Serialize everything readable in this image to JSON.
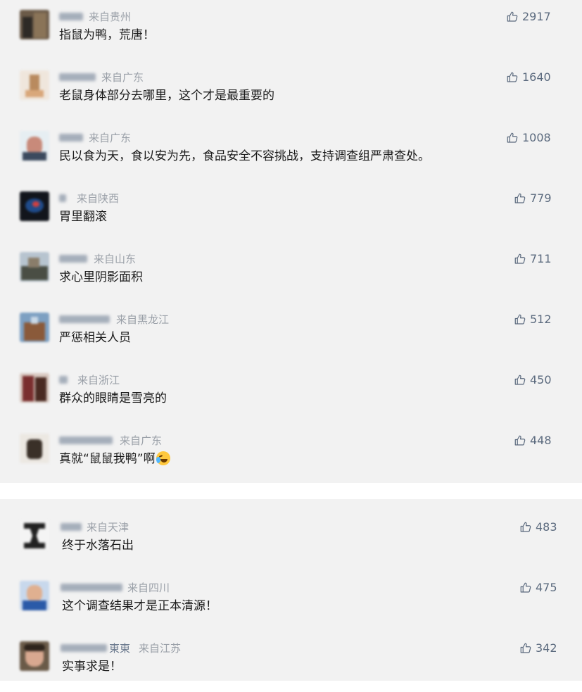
{
  "section_a": {
    "comments": [
      {
        "location": "来自贵州",
        "text": "指鼠为鸭，荒唐！",
        "likes": "2917"
      },
      {
        "location": "来自广东",
        "text": "老鼠身体部分去哪里，这个才是最重要的",
        "likes": "1640"
      },
      {
        "location": "来自广东",
        "text": "民以食为天，食以安为先，食品安全不容挑战，支持调查组严肃查处。",
        "likes": "1008"
      },
      {
        "location": "来自陕西",
        "text": "胃里翻滚",
        "likes": "779"
      },
      {
        "location": "来自山东",
        "text": "求心里阴影面积",
        "likes": "711"
      },
      {
        "location": "来自黑龙江",
        "text": "严惩相关人员",
        "likes": "512"
      },
      {
        "location": "来自浙江",
        "text": "群众的眼睛是雪亮的",
        "likes": "450"
      },
      {
        "location": "来自广东",
        "text": "真就“鼠鼠我鸭”啊",
        "likes": "448",
        "emoji": "laughing-crying-emoji"
      }
    ]
  },
  "section_b": {
    "comments": [
      {
        "location": "来自天津",
        "text": "终于水落石出",
        "likes": "483"
      },
      {
        "location": "来自四川",
        "text": "这个调查结果才是正本清源！",
        "likes": "475"
      },
      {
        "nickname_visible": "東東",
        "location": "来自江苏",
        "text": "实事求是！",
        "likes": "342"
      }
    ]
  },
  "icons": {
    "like": "thumbs-up-outline-icon"
  },
  "colors": {
    "background": "#f2f2f2",
    "divider": "#ffffff",
    "text": "#1a1a1a",
    "location": "#9aa0a8",
    "like": "#5b6a7e"
  }
}
